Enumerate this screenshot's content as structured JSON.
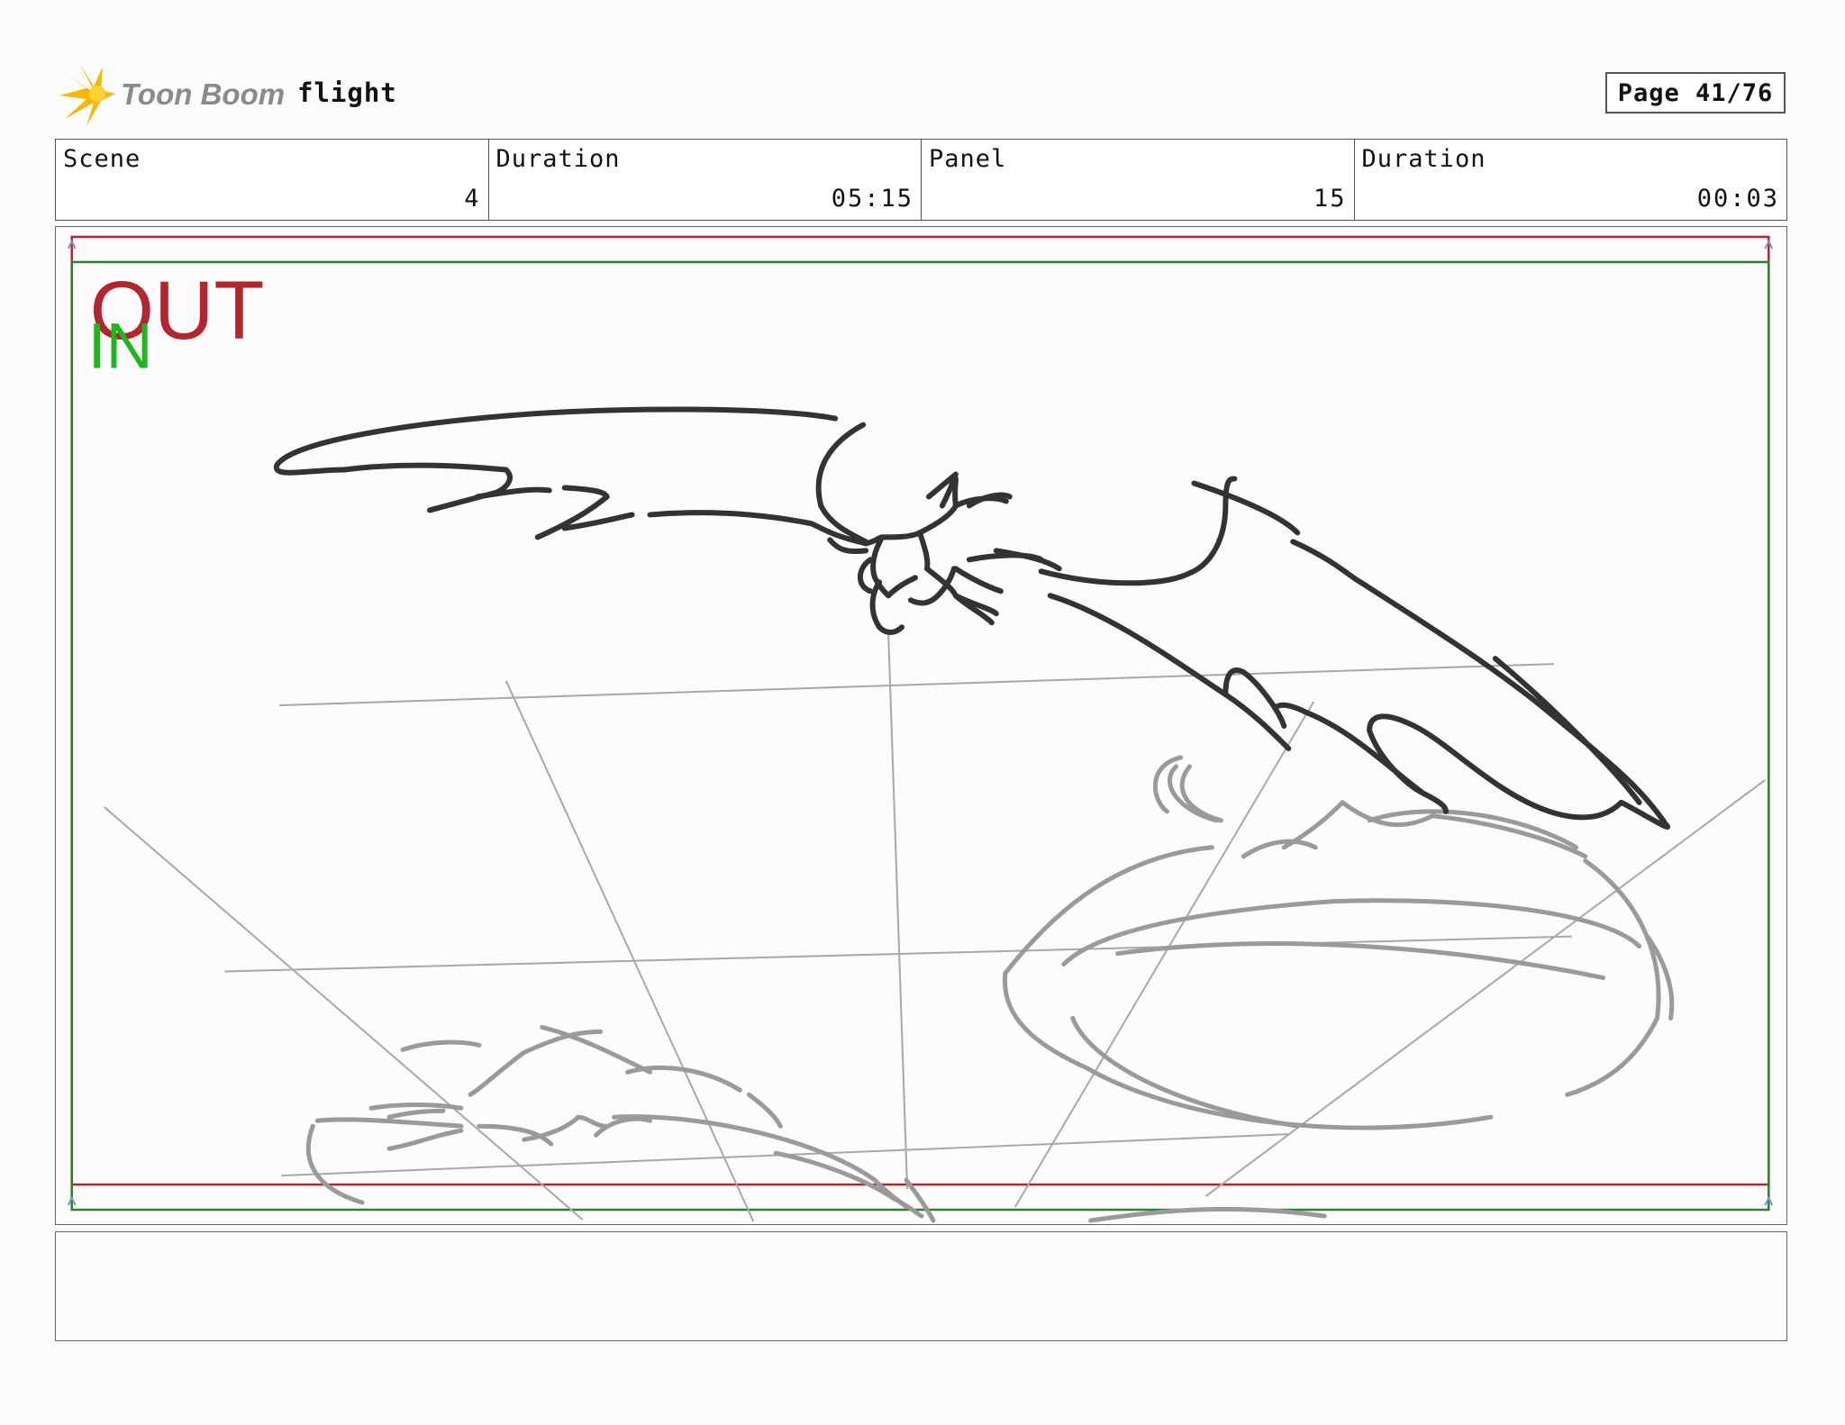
{
  "header": {
    "brand_name": "Toon Boom",
    "document_title": "flight",
    "page_label": "Page 41/76"
  },
  "info": [
    {
      "label": "Scene",
      "value": "4"
    },
    {
      "label": "Duration",
      "value": "05:15"
    },
    {
      "label": "Panel",
      "value": "15"
    },
    {
      "label": "Duration",
      "value": "00:03"
    }
  ],
  "panel": {
    "out_text": "OUT",
    "in_text": "IN"
  },
  "caption": "",
  "colors": {
    "out_frame": "#b3262e",
    "in_frame": "#2e7d32",
    "sketch_dark": "#333333",
    "sketch_light": "#9a9a9a",
    "logo_yellow": "#f5b800"
  }
}
